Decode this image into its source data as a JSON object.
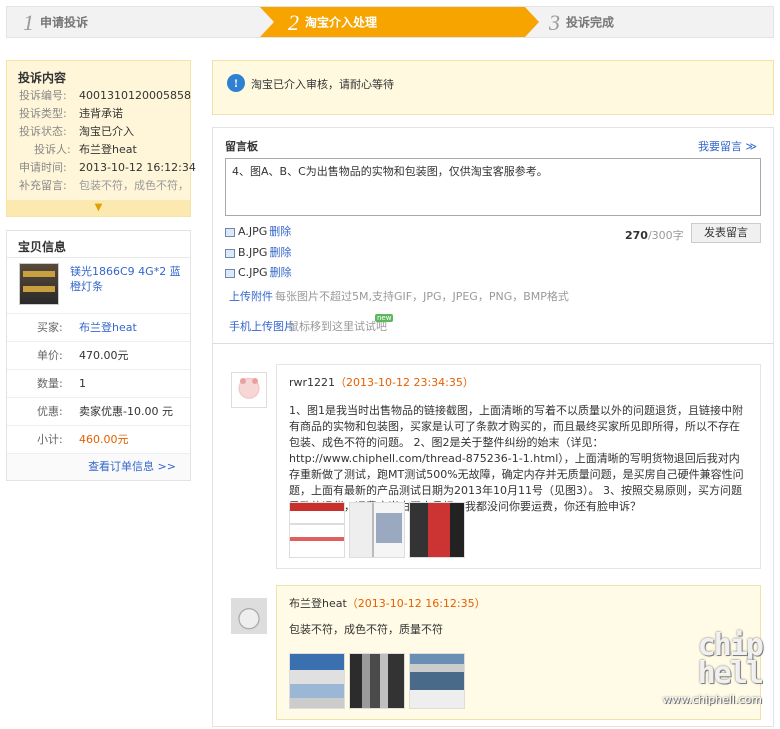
{
  "steps": [
    {
      "num": "1",
      "label": "申请投诉"
    },
    {
      "num": "2",
      "label": "淘宝介入处理"
    },
    {
      "num": "3",
      "label": "投诉完成"
    }
  ],
  "complaint": {
    "title": "投诉内容",
    "rows": [
      {
        "k": "投诉编号:",
        "v": "4001310120005858"
      },
      {
        "k": "投诉类型:",
        "v": "违背承诺"
      },
      {
        "k": "投诉状态:",
        "v": "淘宝已介入"
      },
      {
        "k": "投诉人:",
        "v": "布兰登heat"
      },
      {
        "k": "申请时间:",
        "v": "2013-10-12 16:12:34"
      },
      {
        "k": "补充留言:",
        "v": "包装不符，成色不符，"
      }
    ],
    "expand_icon": "chevron-down-icon"
  },
  "item": {
    "title": "宝贝信息",
    "name": "镁光1866C9 4G*2 蓝橙灯条",
    "rows": [
      {
        "k": "买家:",
        "v": "布兰登heat"
      },
      {
        "k": "单价:",
        "v": "470.00元"
      },
      {
        "k": "数量:",
        "v": "1"
      },
      {
        "k": "优惠:",
        "v": "卖家优惠-10.00 元"
      },
      {
        "k": "小计:",
        "v": "460.00元"
      }
    ],
    "order_link": "查看订单信息 >>"
  },
  "notice": {
    "message": "淘宝已介入审核，请耐心等待"
  },
  "board": {
    "title": "留言板",
    "post_link": "我要留言 ≫",
    "message_text": "4、图A、B、C为出售物品的实物和包装图，仅供淘宝客服参考。",
    "counter_used": "270",
    "counter_total": "/300字",
    "send_label": "发表留言",
    "attachments": [
      {
        "name": "A.JPG",
        "del": "删除"
      },
      {
        "name": "B.JPG",
        "del": "删除"
      },
      {
        "name": "C.JPG",
        "del": "删除"
      }
    ],
    "upload_label": "上传附件",
    "upload_hint": "每张图片不超过5M,支持GIF，JPG，JPEG，PNG，BMP格式",
    "mobile_label": "手机上传图片",
    "mobile_hint": "鼠标移到这里试试吧",
    "new_badge": "new"
  },
  "comments": [
    {
      "user": "rwr1221",
      "time": "（2013-10-12 23:34:35）",
      "body": "1、图1是我当时出售物品的链接截图，上面清晰的写着不以质量以外的问题退货，且链接中附有商品的实物和包装图，买家是认可了条款才购买的，而且最终买家所见即所得，所以不存在包装、成色不符的问题。 2、图2是关于整件纠纷的始末（详见：http://www.chiphell.com/thread-875236-1-1.html），上面清晰的写明货物退回后我对内存重新做了测试，跑MT测试500%无故障，确定内存并无质量问题，是买房自己硬件兼容性问题，上面有最新的产品测试日期为2013年10月11号（见图3）。 3、按照交易原则，买方问题导致的退货，运费应当由买方承担，我都没问你要运费，你还有脸申诉？"
    },
    {
      "user": "布兰登heat",
      "time": "（2013-10-12 16:12:35）",
      "body": "包装不符，成色不符，质量不符"
    }
  ],
  "watermark": {
    "logo": "chip\nhell",
    "url": "www.chiphell.com"
  }
}
